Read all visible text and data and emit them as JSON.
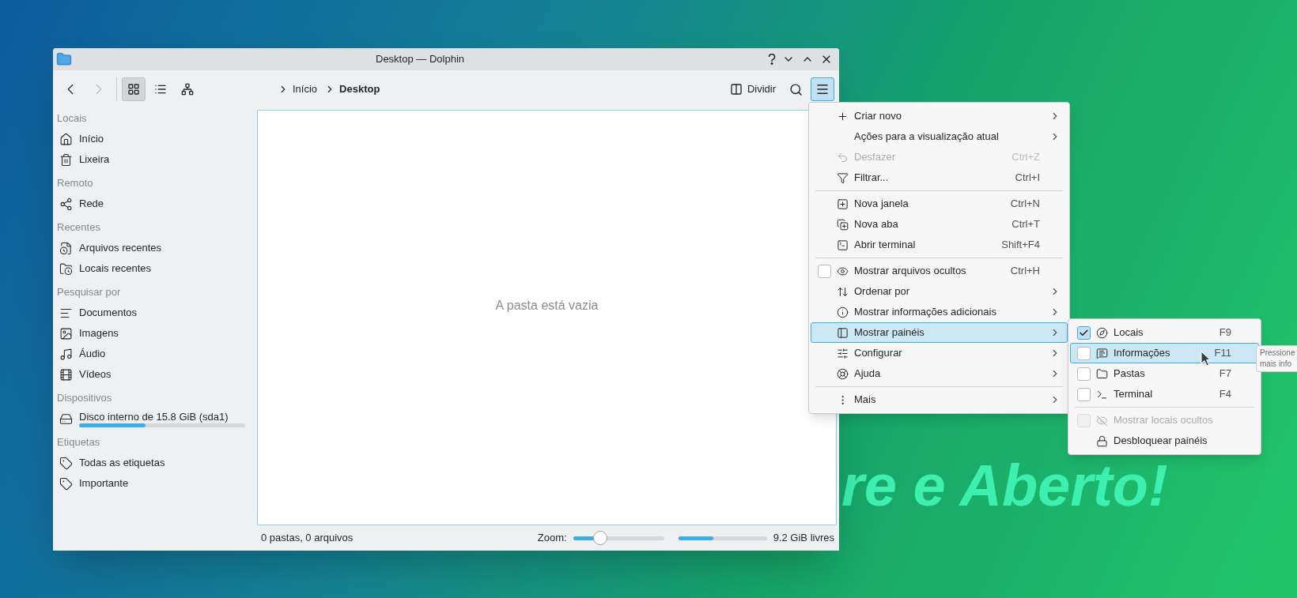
{
  "desktop": {
    "wallpaper_text": "re e Aberto!"
  },
  "window": {
    "title": "Desktop — Dolphin"
  },
  "toolbar": {
    "view_modes": [
      {
        "kind": "icons",
        "selected": true
      },
      {
        "kind": "details",
        "selected": false
      },
      {
        "kind": "tree",
        "selected": false
      }
    ],
    "breadcrumb": [
      "Início",
      "Desktop"
    ],
    "split_label": "Dividir",
    "menu_button": {
      "pressed": true
    }
  },
  "sidebar": {
    "sections": [
      {
        "title": "Locais",
        "items": [
          {
            "label": "Início"
          },
          {
            "label": "Lixeira"
          }
        ]
      },
      {
        "title": "Remoto",
        "items": [
          {
            "label": "Rede"
          }
        ]
      },
      {
        "title": "Recentes",
        "items": [
          {
            "label": "Arquivos recentes"
          },
          {
            "label": "Locais recentes"
          }
        ]
      },
      {
        "title": "Pesquisar por",
        "items": [
          {
            "label": "Documentos"
          },
          {
            "label": "Imagens"
          },
          {
            "label": "Áudio"
          },
          {
            "label": "Vídeos"
          }
        ]
      },
      {
        "title": "Dispositivos",
        "items": [
          {
            "label": "Disco interno de 15.8 GiB (sda1)",
            "level": 0.4
          }
        ]
      },
      {
        "title": "Etiquetas",
        "items": [
          {
            "label": "Todas as etiquetas"
          },
          {
            "label": "Importante"
          }
        ]
      }
    ]
  },
  "content": {
    "empty_message": "A pasta está vazia"
  },
  "status_bar": {
    "summary": "0 pastas, 0 arquivos",
    "zoom_label": "Zoom:",
    "zoom": {
      "level": 0.3
    },
    "free_space": {
      "level": 0.4
    },
    "free_label": "9.2 GiB livres"
  },
  "menu": {
    "groups": [
      {
        "items": [
          {
            "kind": "action",
            "label": "Criar novo",
            "submenu": true,
            "disabled": false,
            "selected": false
          },
          {
            "kind": "action",
            "label": "Ações para a visualização atual",
            "submenu": true,
            "disabled": false,
            "selected": false
          },
          {
            "kind": "action",
            "label": "Desfazer",
            "shortcut": "Ctrl+Z",
            "submenu": false,
            "disabled": true,
            "selected": false
          },
          {
            "kind": "action",
            "label": "Filtrar...",
            "shortcut": "Ctrl+I",
            "submenu": false,
            "disabled": false,
            "selected": false
          }
        ]
      },
      {
        "items": [
          {
            "kind": "action",
            "label": "Nova janela",
            "shortcut": "Ctrl+N",
            "submenu": false,
            "disabled": false,
            "selected": false
          },
          {
            "kind": "action",
            "label": "Nova aba",
            "shortcut": "Ctrl+T",
            "submenu": false,
            "disabled": false,
            "selected": false
          },
          {
            "kind": "action",
            "label": "Abrir terminal",
            "shortcut": "Shift+F4",
            "submenu": false,
            "disabled": false,
            "selected": false
          }
        ]
      },
      {
        "items": [
          {
            "kind": "check",
            "label": "Mostrar arquivos ocultos",
            "shortcut": "Ctrl+H",
            "checked": false,
            "submenu": false,
            "disabled": false,
            "selected": false
          },
          {
            "kind": "action",
            "label": "Ordenar por",
            "submenu": true,
            "disabled": false,
            "selected": false
          },
          {
            "kind": "action",
            "label": "Mostrar informações adicionais",
            "submenu": true,
            "disabled": false,
            "selected": false
          },
          {
            "kind": "action",
            "label": "Mostrar painéis",
            "submenu": true,
            "disabled": false,
            "selected": true
          },
          {
            "kind": "action",
            "label": "Configurar",
            "submenu": true,
            "disabled": false,
            "selected": false
          },
          {
            "kind": "action",
            "label": "Ajuda",
            "submenu": true,
            "disabled": false,
            "selected": false
          }
        ]
      },
      {
        "items": [
          {
            "kind": "action",
            "label": "Mais",
            "submenu": true,
            "disabled": false,
            "selected": false
          }
        ]
      }
    ]
  },
  "submenu": {
    "groups": [
      {
        "items": [
          {
            "kind": "check",
            "label": "Locais",
            "shortcut": "F9",
            "checked": true,
            "submenu": false,
            "disabled": false,
            "selected": false
          },
          {
            "kind": "check",
            "label": "Informações",
            "shortcut": "F11",
            "checked": false,
            "submenu": false,
            "disabled": false,
            "selected": true
          },
          {
            "kind": "check",
            "label": "Pastas",
            "shortcut": "F7",
            "checked": false,
            "submenu": false,
            "disabled": false,
            "selected": false
          },
          {
            "kind": "check",
            "label": "Terminal",
            "shortcut": "F4",
            "checked": false,
            "submenu": false,
            "disabled": false,
            "selected": false
          }
        ]
      },
      {
        "items": [
          {
            "kind": "check",
            "label": "Mostrar locais ocultos",
            "checked": false,
            "submenu": false,
            "disabled": true,
            "selected": false
          },
          {
            "kind": "action",
            "label": "Desbloquear painéis",
            "submenu": false,
            "disabled": false,
            "selected": false
          }
        ]
      }
    ]
  },
  "tooltip": {
    "lines": [
      "Pressione",
      "mais info"
    ]
  }
}
